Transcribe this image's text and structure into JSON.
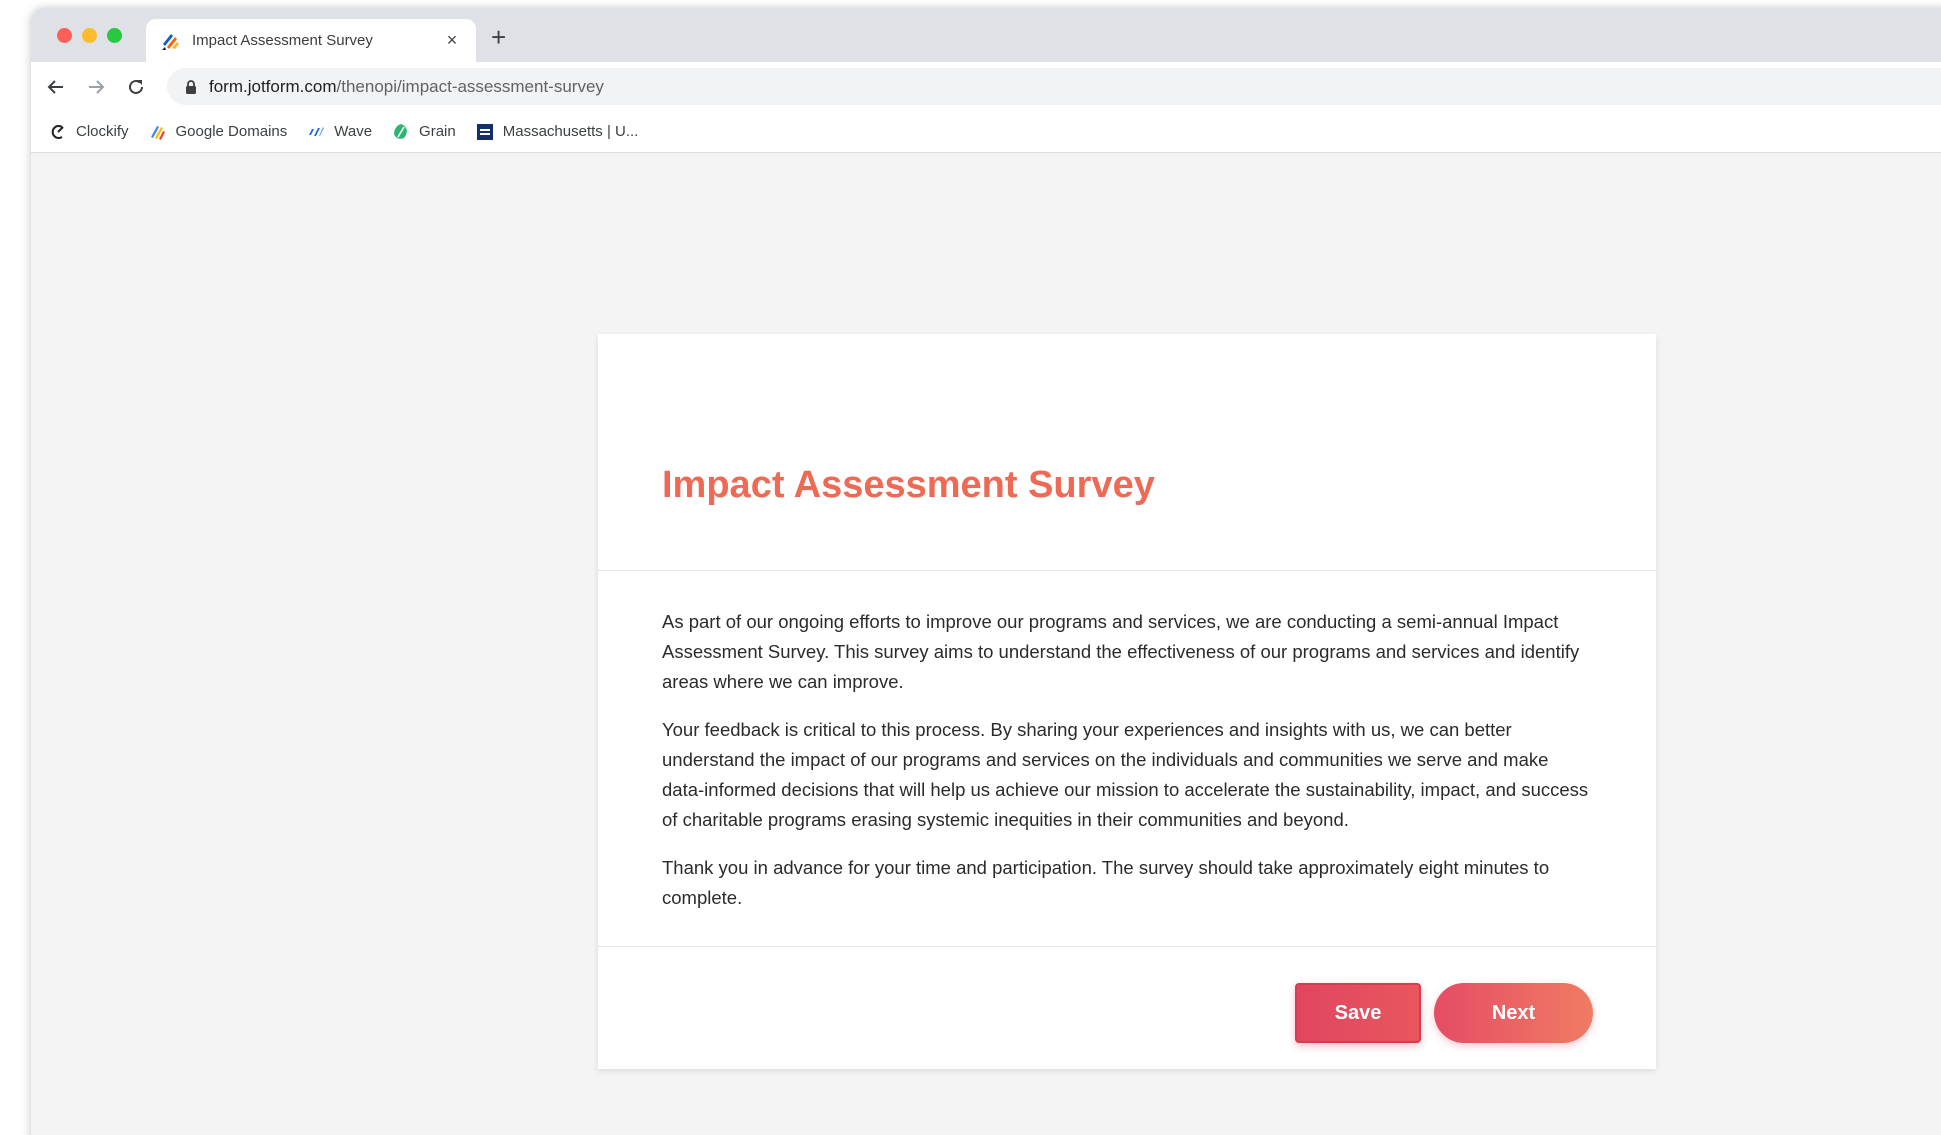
{
  "browser": {
    "tab_title": "Impact Assessment Survey",
    "tab_close": "×",
    "new_tab": "+",
    "url_host": "form.jotform.com",
    "url_path": "/thenopi/impact-assessment-survey",
    "bookmarks": [
      {
        "label": "Clockify",
        "icon": "clockify-icon"
      },
      {
        "label": "Google Domains",
        "icon": "google-domains-icon"
      },
      {
        "label": "Wave",
        "icon": "wave-icon"
      },
      {
        "label": "Grain",
        "icon": "grain-icon"
      },
      {
        "label": "Massachusetts | U...",
        "icon": "massachusetts-icon"
      }
    ]
  },
  "form": {
    "title": "Impact Assessment Survey",
    "paragraphs": [
      "As part of our ongoing efforts to improve our programs and services, we are conducting a semi-annual Impact Assessment Survey. This survey aims to understand the effectiveness of our programs and services and identify areas where we can improve.",
      "Your feedback is critical to this process. By sharing your experiences and insights with us, we can better understand the impact of our programs and services on the individuals and communities we serve and make data-informed decisions that will help us achieve our mission to accelerate the sustainability, impact, and success of charitable programs erasing systemic inequities in their communities and beyond.",
      "Thank you in advance for your time and participation. The survey should take approximately eight minutes to complete."
    ],
    "save_label": "Save",
    "next_label": "Next"
  },
  "colors": {
    "title": "#ee6a55",
    "save_button": "#e04660",
    "next_button_start": "#e54c65",
    "next_button_end": "#ef7c63"
  }
}
